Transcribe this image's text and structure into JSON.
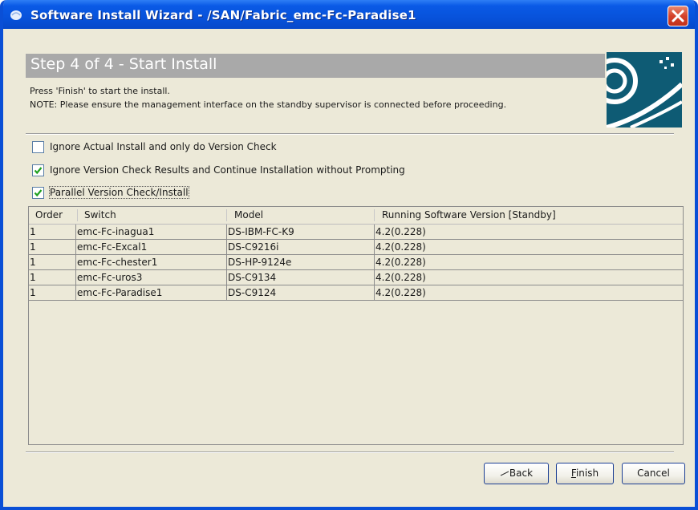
{
  "window": {
    "title": "Software Install Wizard - /SAN/Fabric_emc-Fc-Paradise1",
    "colors": {
      "titlebar": "#0751d9",
      "close": "#d4412a",
      "banner": "#a9a9a9"
    }
  },
  "step": {
    "title": "Step 4 of 4 - Start Install",
    "line1": "Press 'Finish' to start the install.",
    "line2": "NOTE: Please ensure the management interface on the standby supervisor is connected before proceeding."
  },
  "options": [
    {
      "label": "Ignore Actual Install and only do Version Check",
      "checked": false
    },
    {
      "label": "Ignore Version Check Results and Continue Installation without Prompting",
      "checked": true
    },
    {
      "label": "Parallel Version Check/Install",
      "checked": true
    }
  ],
  "table": {
    "columns": [
      "Order",
      "Switch",
      "Model",
      "Running Software Version [Standby]"
    ],
    "rows": [
      [
        "1",
        "emc-Fc-inagua1",
        "DS-IBM-FC-K9",
        "4.2(0.228)"
      ],
      [
        "1",
        "emc-Fc-Excal1",
        "DS-C9216i",
        "4.2(0.228)"
      ],
      [
        "1",
        "emc-Fc-chester1",
        "DS-HP-9124e",
        "4.2(0.228)"
      ],
      [
        "1",
        "emc-Fc-uros3",
        "DS-C9134",
        "4.2(0.228)"
      ],
      [
        "1",
        "emc-Fc-Paradise1",
        "DS-C9124",
        "4.2(0.228)"
      ]
    ]
  },
  "buttons": {
    "back": "Back",
    "finish_first": "F",
    "finish_rest": "inish",
    "cancel": "Cancel"
  },
  "icons": {
    "app": "wizard-icon",
    "close": "close-icon",
    "check": "checkmark-icon",
    "back": "back-arrow-icon"
  }
}
